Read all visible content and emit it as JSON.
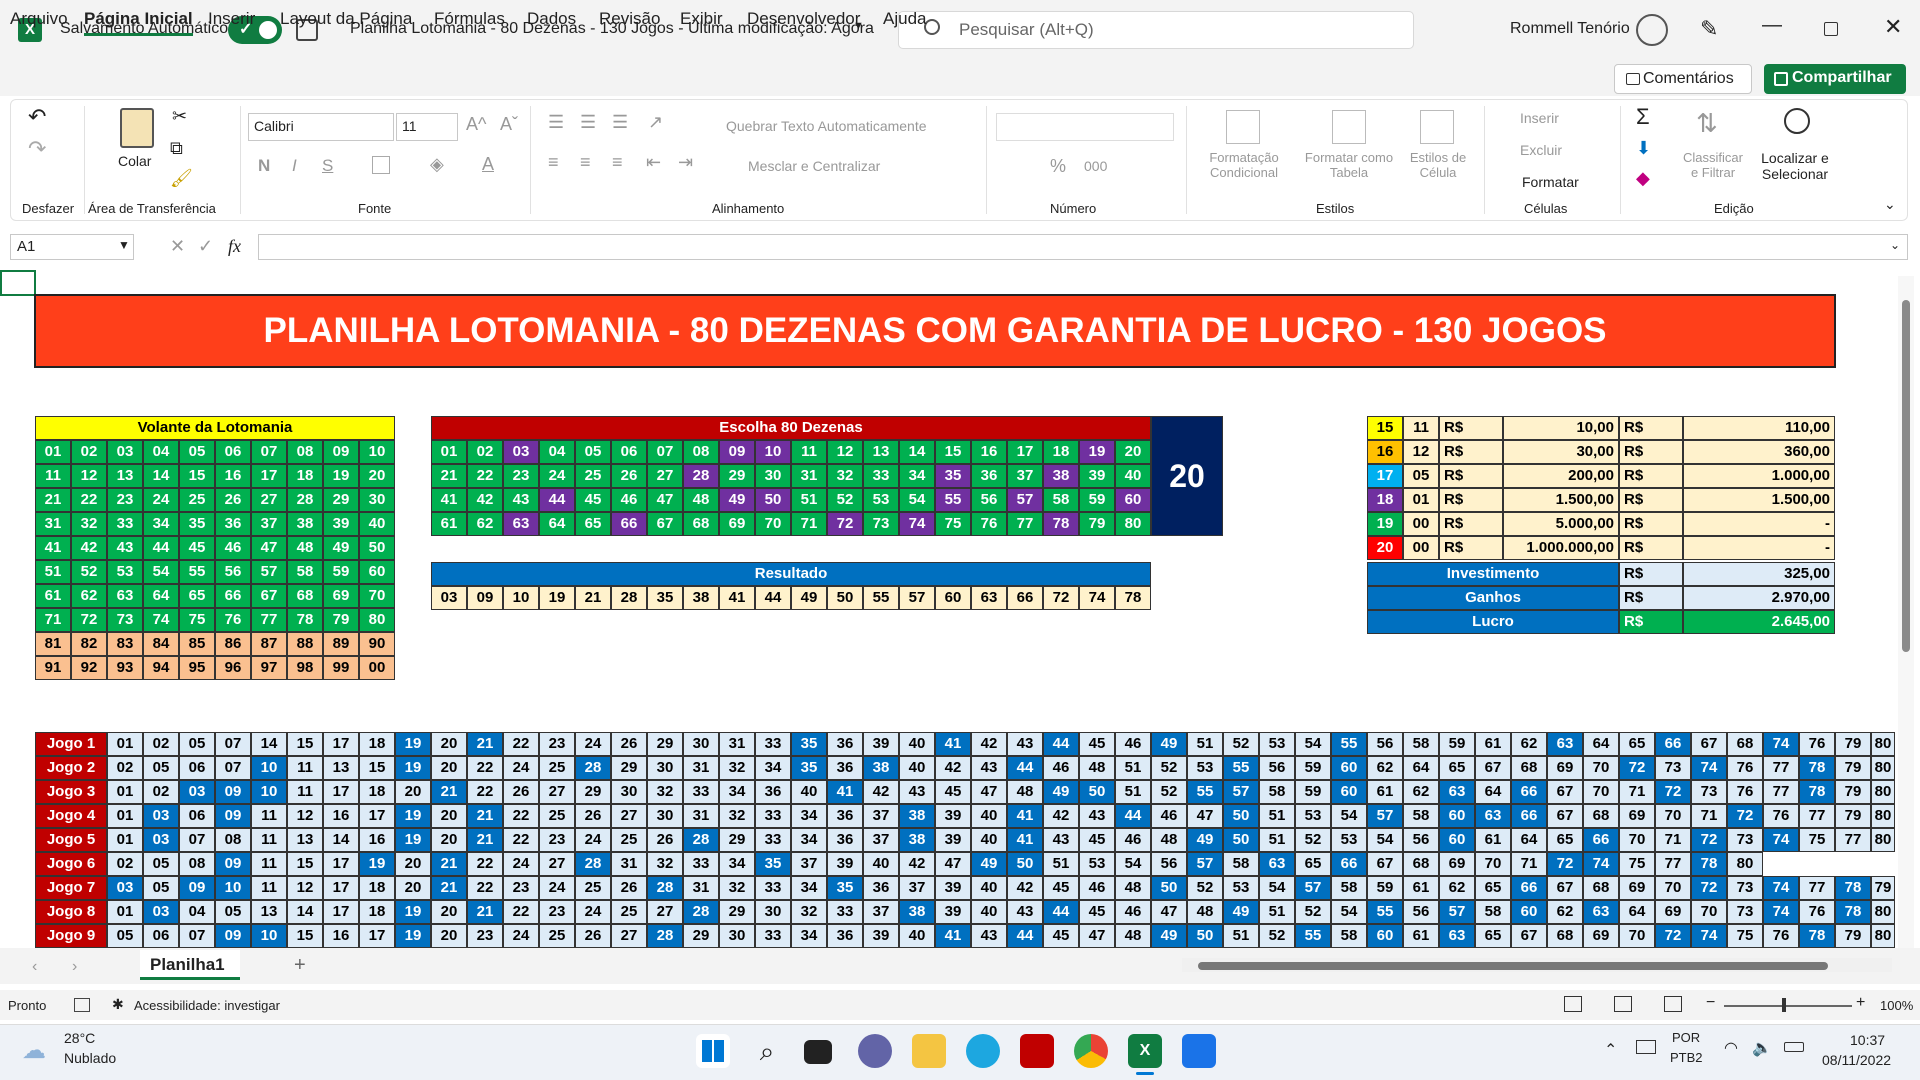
{
  "app": {
    "autosave_label": "Salvamento Automático",
    "autosave_state": "Sim",
    "document_title": "Planilha Lotomania - 80 Dezenas - 130 Jogos  -  Última modificação: Agora",
    "search_placeholder": "Pesquisar (Alt+Q)",
    "user_name": "Rommell Tenório"
  },
  "menu": {
    "items": [
      "Arquivo",
      "Página Inicial",
      "Inserir",
      "Layout da Página",
      "Fórmulas",
      "Dados",
      "Revisão",
      "Exibir",
      "Desenvolvedor",
      "Ajuda"
    ],
    "comments_label": "Comentários",
    "share_label": "Compartilhar"
  },
  "ribbon": {
    "undo_group": "Desfazer",
    "paste_label": "Colar",
    "clipboard_group": "Área de Transferência",
    "font_name": "Calibri",
    "font_size": "11",
    "bold": "N",
    "italic": "I",
    "underline": "S",
    "font_group": "Fonte",
    "wrap_text": "Quebrar Texto Automaticamente",
    "merge_center": "Mesclar e Centralizar",
    "alignment_group": "Alinhamento",
    "percent": "%",
    "thousands": "000",
    "number_group": "Número",
    "cond_format": [
      "Formatação",
      "Condicional"
    ],
    "format_table": [
      "Formatar como",
      "Tabela"
    ],
    "cell_styles": [
      "Estilos de",
      "Célula"
    ],
    "styles_group": "Estilos",
    "insert": "Inserir",
    "delete": "Excluir",
    "format": "Formatar",
    "cells_group": "Células",
    "sort_filter": [
      "Classificar",
      "e Filtrar"
    ],
    "find_select": [
      "Localizar e",
      "Selecionar"
    ],
    "editing_group": "Edição"
  },
  "formula": {
    "name_box": "A1",
    "fx": "fx",
    "value": ""
  },
  "sheet": {
    "banner": "PLANILHA LOTOMANIA - 80 DEZENAS COM GARANTIA DE LUCRO - 130 JOGOS",
    "volante_title": "Volante da Lotomania",
    "escolha_title": "Escolha 80 Dezenas",
    "escolha_count": "20",
    "escolha_purple": [
      "03",
      "09",
      "10",
      "19",
      "28",
      "35",
      "38",
      "44",
      "49",
      "50",
      "55",
      "57",
      "60",
      "63",
      "66",
      "72",
      "74",
      "78"
    ],
    "resultado_title": "Resultado",
    "resultado": [
      "03",
      "09",
      "10",
      "19",
      "21",
      "28",
      "35",
      "38",
      "41",
      "44",
      "49",
      "50",
      "55",
      "57",
      "60",
      "63",
      "66",
      "72",
      "74",
      "78"
    ],
    "prizes": [
      [
        "15",
        "11",
        "R$",
        "10,00",
        "R$",
        "110,00"
      ],
      [
        "16",
        "12",
        "R$",
        "30,00",
        "R$",
        "360,00"
      ],
      [
        "17",
        "05",
        "R$",
        "200,00",
        "R$",
        "1.000,00"
      ],
      [
        "18",
        "01",
        "R$",
        "1.500,00",
        "R$",
        "1.500,00"
      ],
      [
        "19",
        "00",
        "R$",
        "5.000,00",
        "R$",
        "-"
      ],
      [
        "20",
        "00",
        "R$",
        "1.000.000,00",
        "R$",
        "-"
      ]
    ],
    "summary": [
      [
        "Investimento",
        "R$",
        "325,00"
      ],
      [
        "Ganhos",
        "R$",
        "2.970,00"
      ],
      [
        "Lucro",
        "R$",
        "2.645,00"
      ]
    ],
    "games": [
      {
        "label": "Jogo 1",
        "nums": [
          "01",
          "02",
          "05",
          "07",
          "14",
          "15",
          "17",
          "18",
          "19",
          "20",
          "21",
          "22",
          "23",
          "24",
          "26",
          "29",
          "30",
          "31",
          "33",
          "35",
          "36",
          "39",
          "40",
          "41",
          "42",
          "43",
          "44",
          "45",
          "46",
          "49",
          "51",
          "52",
          "53",
          "54",
          "55",
          "56",
          "58",
          "59",
          "61",
          "62",
          "63",
          "64",
          "65",
          "66",
          "67",
          "68",
          "74",
          "76",
          "79",
          "80"
        ]
      },
      {
        "label": "Jogo 2",
        "nums": [
          "02",
          "05",
          "06",
          "07",
          "10",
          "11",
          "13",
          "15",
          "19",
          "20",
          "22",
          "24",
          "25",
          "28",
          "29",
          "30",
          "31",
          "32",
          "34",
          "35",
          "36",
          "38",
          "40",
          "42",
          "43",
          "44",
          "46",
          "48",
          "51",
          "52",
          "53",
          "55",
          "56",
          "59",
          "60",
          "62",
          "64",
          "65",
          "67",
          "68",
          "69",
          "70",
          "72",
          "73",
          "74",
          "76",
          "77",
          "78",
          "79",
          "80"
        ]
      },
      {
        "label": "Jogo 3",
        "nums": [
          "01",
          "02",
          "03",
          "09",
          "10",
          "11",
          "17",
          "18",
          "20",
          "21",
          "22",
          "26",
          "27",
          "29",
          "30",
          "32",
          "33",
          "34",
          "36",
          "40",
          "41",
          "42",
          "43",
          "45",
          "47",
          "48",
          "49",
          "50",
          "51",
          "52",
          "55",
          "57",
          "58",
          "59",
          "60",
          "61",
          "62",
          "63",
          "64",
          "66",
          "67",
          "70",
          "71",
          "72",
          "73",
          "76",
          "77",
          "78",
          "79",
          "80"
        ]
      },
      {
        "label": "Jogo 4",
        "nums": [
          "01",
          "03",
          "06",
          "09",
          "11",
          "12",
          "16",
          "17",
          "19",
          "20",
          "21",
          "22",
          "25",
          "26",
          "27",
          "30",
          "31",
          "32",
          "33",
          "34",
          "36",
          "37",
          "38",
          "39",
          "40",
          "41",
          "42",
          "43",
          "44",
          "46",
          "47",
          "50",
          "51",
          "53",
          "54",
          "57",
          "58",
          "60",
          "63",
          "66",
          "67",
          "68",
          "69",
          "70",
          "71",
          "72",
          "76",
          "77",
          "79",
          "80"
        ]
      },
      {
        "label": "Jogo 5",
        "nums": [
          "01",
          "03",
          "07",
          "08",
          "11",
          "13",
          "14",
          "16",
          "19",
          "20",
          "21",
          "22",
          "23",
          "24",
          "25",
          "26",
          "28",
          "29",
          "33",
          "34",
          "36",
          "37",
          "38",
          "39",
          "40",
          "41",
          "43",
          "45",
          "46",
          "48",
          "49",
          "50",
          "51",
          "52",
          "53",
          "54",
          "56",
          "60",
          "61",
          "64",
          "65",
          "66",
          "70",
          "71",
          "72",
          "73",
          "74",
          "75",
          "77",
          "80"
        ]
      },
      {
        "label": "Jogo 6",
        "nums": [
          "02",
          "05",
          "08",
          "09",
          "11",
          "15",
          "17",
          "19",
          "20",
          "21",
          "22",
          "24",
          "27",
          "28",
          "31",
          "32",
          "33",
          "34",
          "35",
          "37",
          "39",
          "40",
          "42",
          "47",
          "49",
          "50",
          "51",
          "53",
          "54",
          "56",
          "57",
          "58",
          "63",
          "65",
          "66",
          "67",
          "68",
          "69",
          "70",
          "71",
          "72",
          "74",
          "75",
          "77",
          "78",
          "80"
        ]
      },
      {
        "label": "Jogo 7",
        "nums": [
          "03",
          "05",
          "09",
          "10",
          "11",
          "12",
          "17",
          "18",
          "20",
          "21",
          "22",
          "23",
          "24",
          "25",
          "26",
          "28",
          "31",
          "32",
          "33",
          "34",
          "35",
          "36",
          "37",
          "39",
          "40",
          "42",
          "45",
          "46",
          "48",
          "50",
          "52",
          "53",
          "54",
          "57",
          "58",
          "59",
          "61",
          "62",
          "65",
          "66",
          "67",
          "68",
          "69",
          "70",
          "72",
          "73",
          "74",
          "77",
          "78",
          "79"
        ]
      },
      {
        "label": "Jogo 8",
        "nums": [
          "01",
          "03",
          "04",
          "05",
          "13",
          "14",
          "17",
          "18",
          "19",
          "20",
          "21",
          "22",
          "23",
          "24",
          "25",
          "27",
          "28",
          "29",
          "30",
          "32",
          "33",
          "37",
          "38",
          "39",
          "40",
          "43",
          "44",
          "45",
          "46",
          "47",
          "48",
          "49",
          "51",
          "52",
          "54",
          "55",
          "56",
          "57",
          "58",
          "60",
          "62",
          "63",
          "64",
          "69",
          "70",
          "73",
          "74",
          "76",
          "78",
          "80"
        ]
      },
      {
        "label": "Jogo 9",
        "nums": [
          "05",
          "06",
          "07",
          "09",
          "10",
          "15",
          "16",
          "17",
          "19",
          "20",
          "23",
          "24",
          "25",
          "26",
          "27",
          "28",
          "29",
          "30",
          "33",
          "34",
          "36",
          "39",
          "40",
          "41",
          "43",
          "44",
          "45",
          "47",
          "48",
          "49",
          "50",
          "51",
          "52",
          "55",
          "58",
          "60",
          "61",
          "63",
          "65",
          "67",
          "68",
          "69",
          "70",
          "72",
          "74",
          "75",
          "76",
          "78",
          "79",
          "80"
        ]
      }
    ]
  },
  "tabs": {
    "sheet_name": "Planilha1",
    "add": "+"
  },
  "status": {
    "ready": "Pronto",
    "accessibility": "Acessibilidade: investigar",
    "zoom": "100%"
  },
  "taskbar": {
    "temp": "28°C",
    "weather": "Nublado",
    "lang1": "POR",
    "lang2": "PTB2",
    "time": "10:37",
    "date": "08/11/2022"
  },
  "colors": {
    "excel_green": "#107c41",
    "banner_red": "#ff3f1a",
    "green": "#00b050",
    "blue": "#0070c0",
    "purple": "#7030a0",
    "light_blue": "#ddebf7",
    "dark_red": "#c00000",
    "yellow": "#ffff00",
    "navy": "#002060"
  }
}
